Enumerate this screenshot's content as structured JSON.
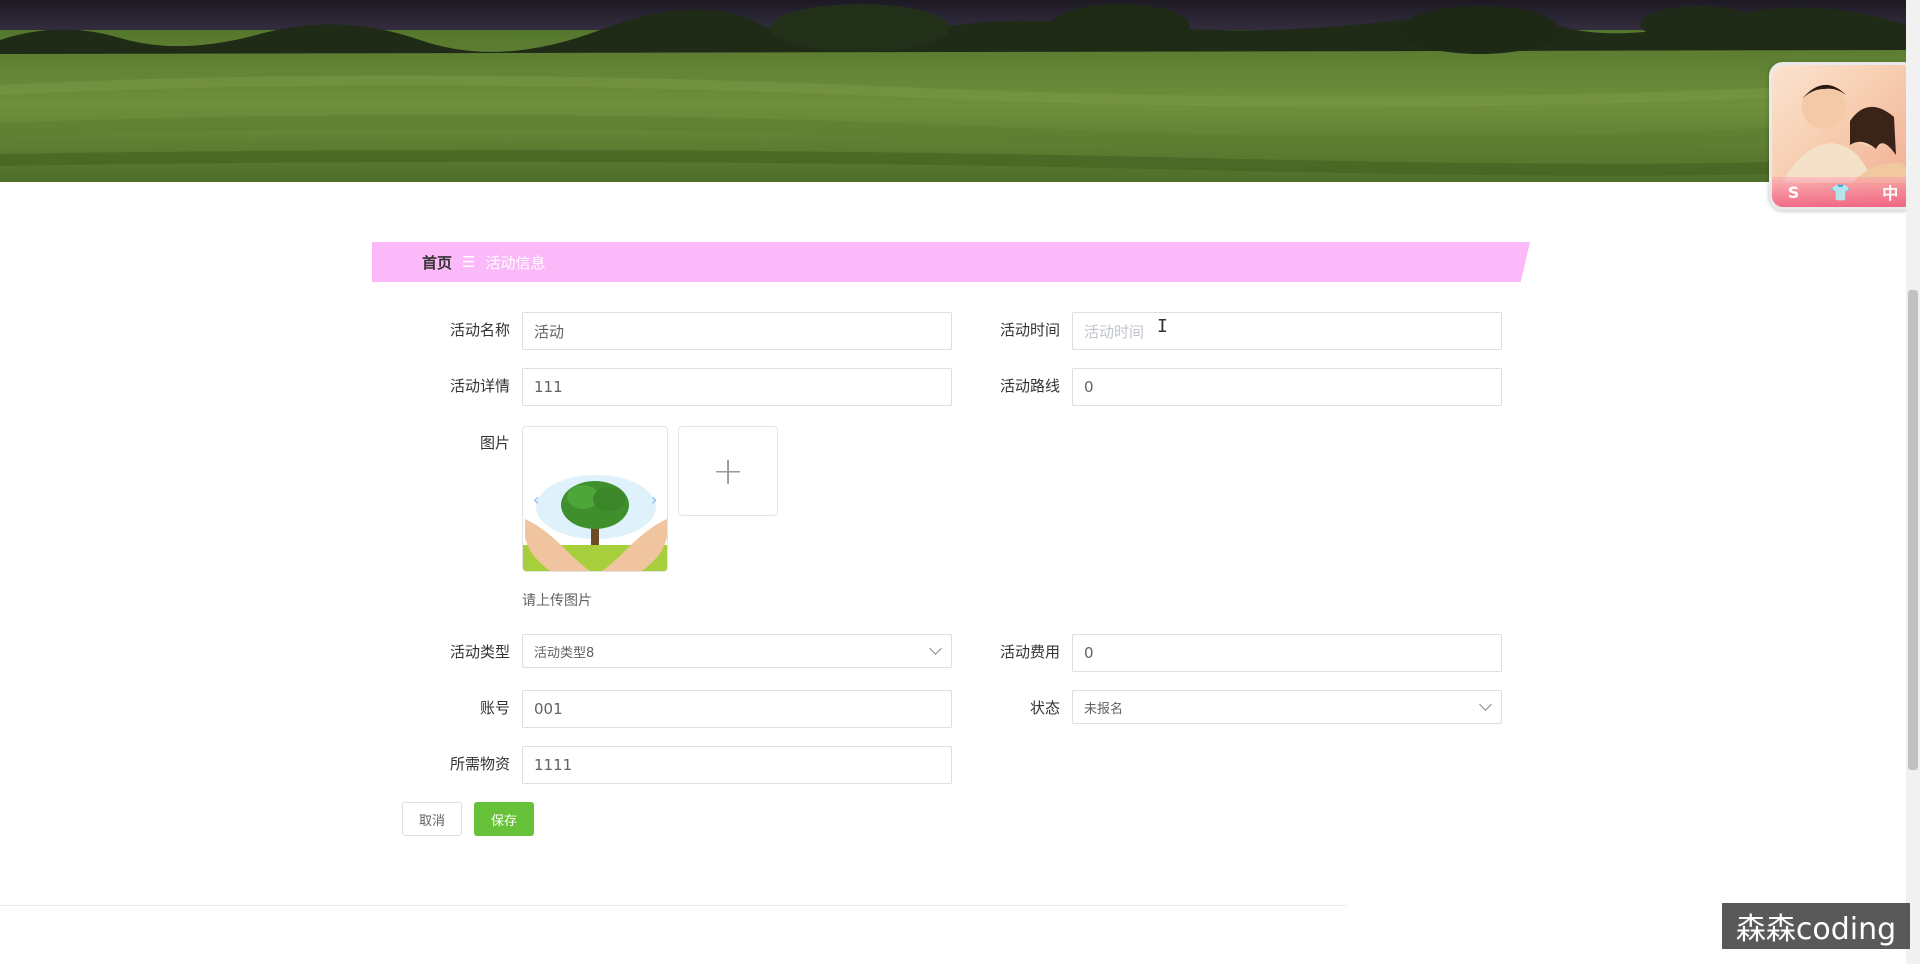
{
  "breadcrumb": {
    "home": "首页",
    "separator": "☰",
    "current": "活动信息"
  },
  "form": {
    "activity_name": {
      "label": "活动名称",
      "value": "活动"
    },
    "activity_time": {
      "label": "活动时间",
      "placeholder": "活动时间",
      "value": ""
    },
    "activity_detail": {
      "label": "活动详情",
      "value": "111"
    },
    "activity_route": {
      "label": "活动路线",
      "value": "0"
    },
    "image": {
      "label": "图片",
      "hint": "请上传图片",
      "add_icon": "plus-icon"
    },
    "activity_type": {
      "label": "活动类型",
      "value": "活动类型8"
    },
    "activity_fee": {
      "label": "活动费用",
      "value": "0"
    },
    "account": {
      "label": "账号",
      "value": "001"
    },
    "status": {
      "label": "状态",
      "value": "未报名"
    },
    "materials": {
      "label": "所需物资",
      "value": "1111"
    }
  },
  "buttons": {
    "cancel": "取消",
    "save": "保存"
  },
  "avatar_bar": [
    "S",
    "👕",
    "中"
  ],
  "watermark": "森森coding",
  "colors": {
    "breadcrumb_bg": "#fbb9f9",
    "save_button": "#67c23a"
  }
}
